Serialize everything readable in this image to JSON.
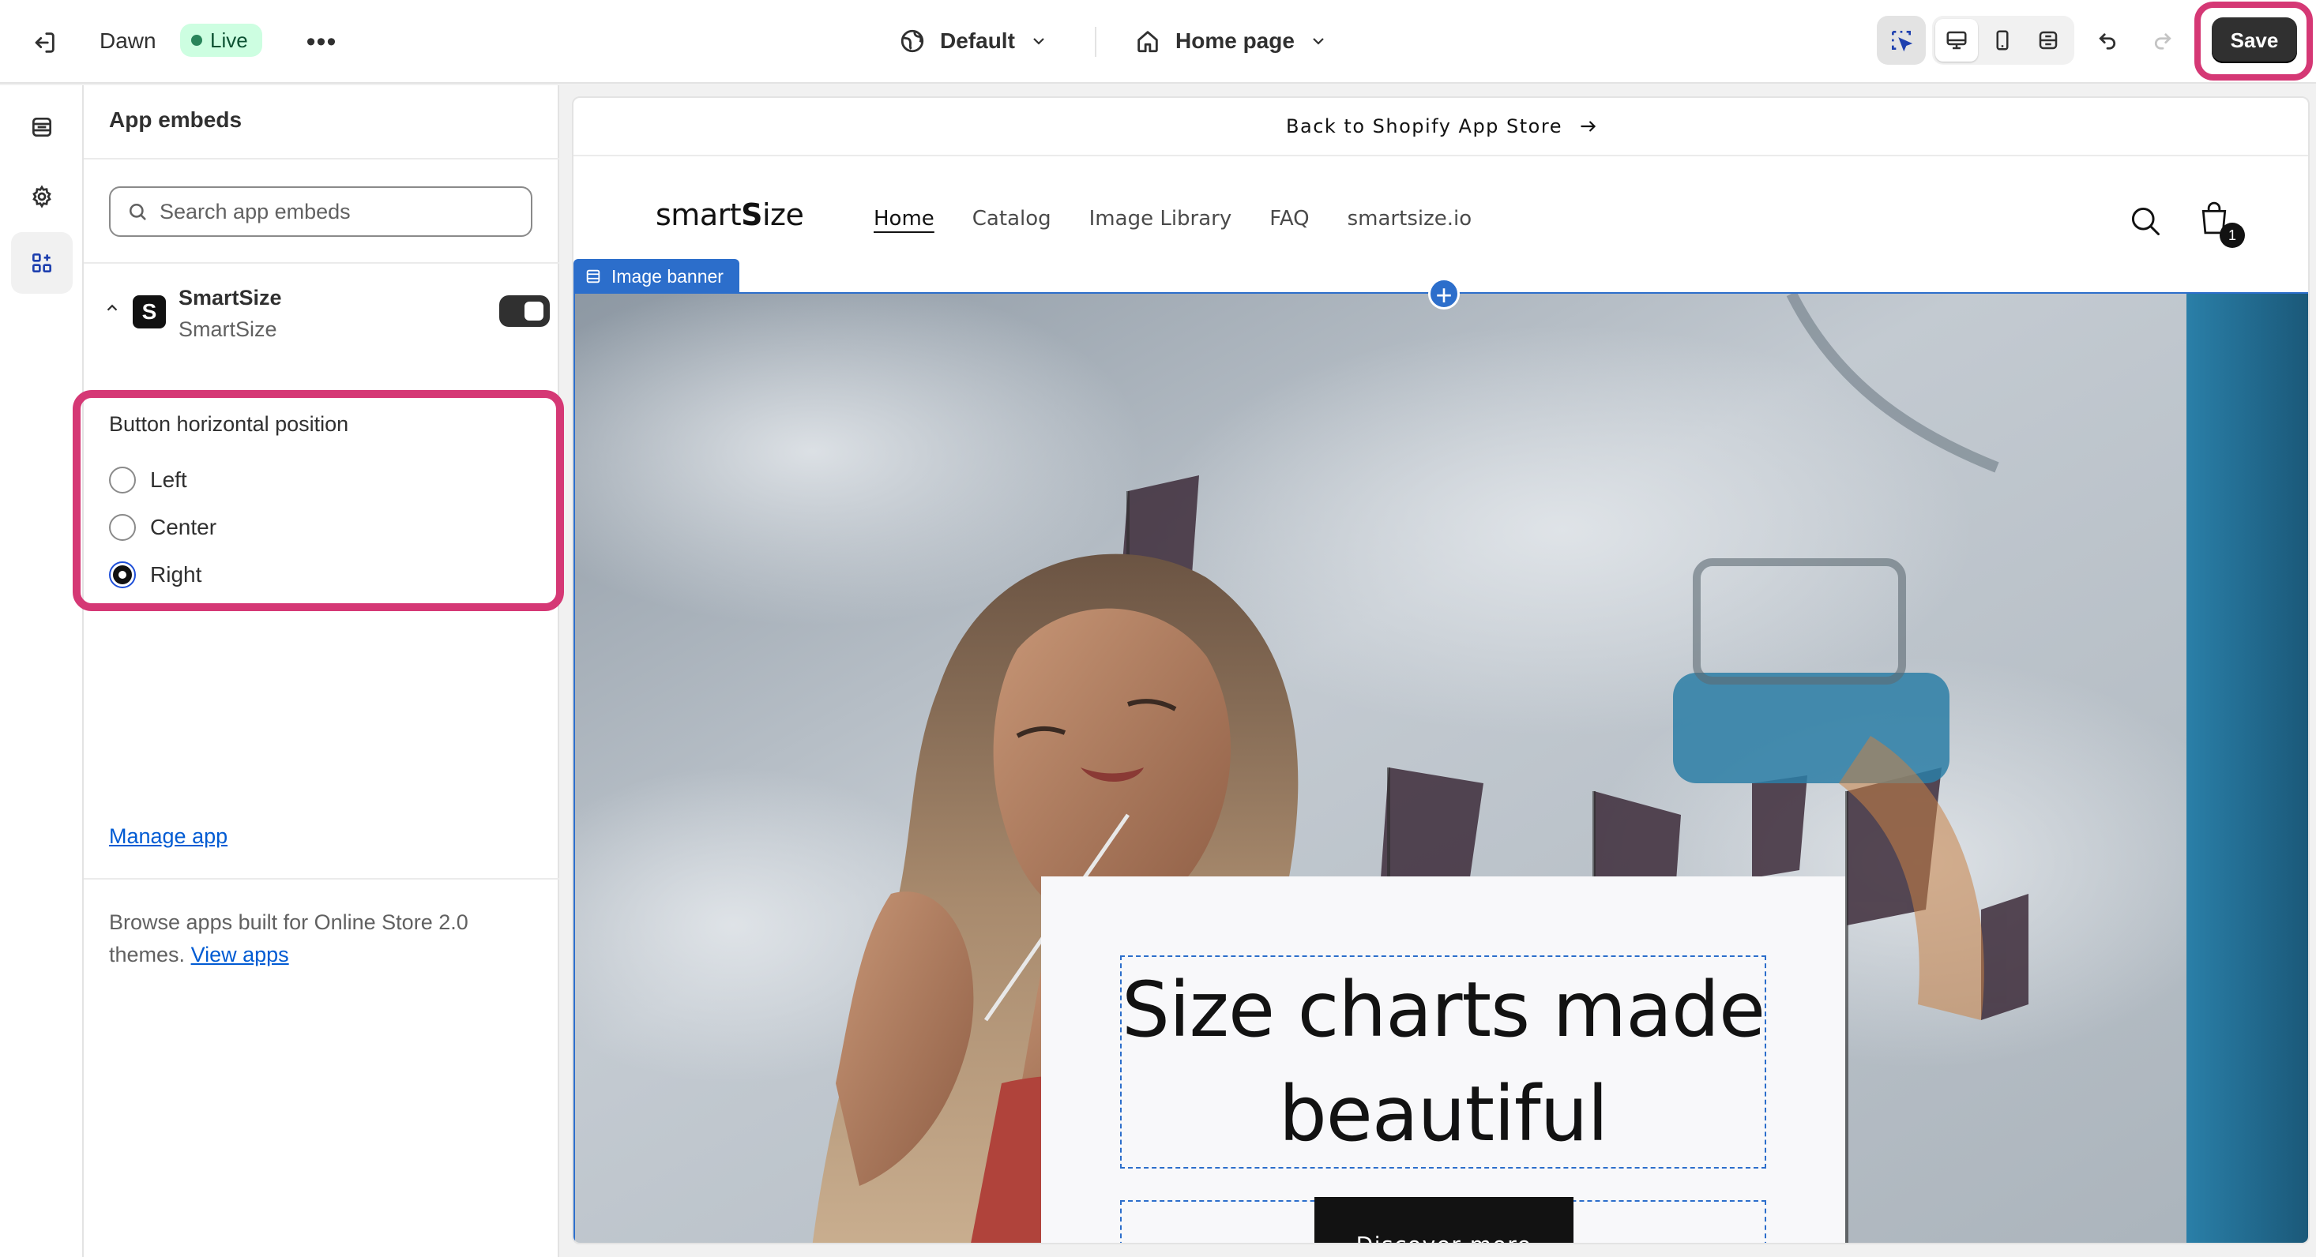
{
  "topbar": {
    "theme_name": "Dawn",
    "live_label": "Live",
    "more_label": "•••",
    "theme_preset": "Default",
    "page_selector": "Home page",
    "save_label": "Save"
  },
  "panel": {
    "title": "App embeds",
    "search_placeholder": "Search app embeds",
    "app": {
      "name": "SmartSize",
      "subtitle": "SmartSize",
      "logo_letter": "S",
      "enabled": true
    },
    "setting": {
      "label": "Button horizontal position",
      "options": [
        "Left",
        "Center",
        "Right"
      ],
      "selected": "Right"
    },
    "manage_link": "Manage app",
    "browse_text": "Browse apps built for Online Store 2.0 themes.",
    "browse_link": "View apps"
  },
  "preview": {
    "announcement": "Back to Shopify App Store",
    "logo_prefix": "smart",
    "logo_bold": "S",
    "logo_suffix": "ize",
    "nav": [
      "Home",
      "Catalog",
      "Image Library",
      "FAQ",
      "smartsize.io"
    ],
    "cart_count": "1",
    "section_tag": "Image banner",
    "heading": "Size charts made beautiful",
    "cta": "Discover more"
  },
  "colors": {
    "accent": "#2c6ecb",
    "highlight": "#d53875",
    "live_bg": "#cdfee1",
    "live_dot": "#29845a",
    "save_bg": "#303030"
  },
  "icons": [
    "exit-icon",
    "globe-icon",
    "home-icon",
    "chevron-down-icon",
    "inspector-icon",
    "desktop-icon",
    "mobile-icon",
    "fullscreen-icon",
    "undo-icon",
    "redo-icon",
    "sections-icon",
    "settings-gear-icon",
    "app-embeds-icon",
    "search-icon",
    "chevron-up-icon",
    "arrow-right-icon",
    "cart-icon"
  ]
}
